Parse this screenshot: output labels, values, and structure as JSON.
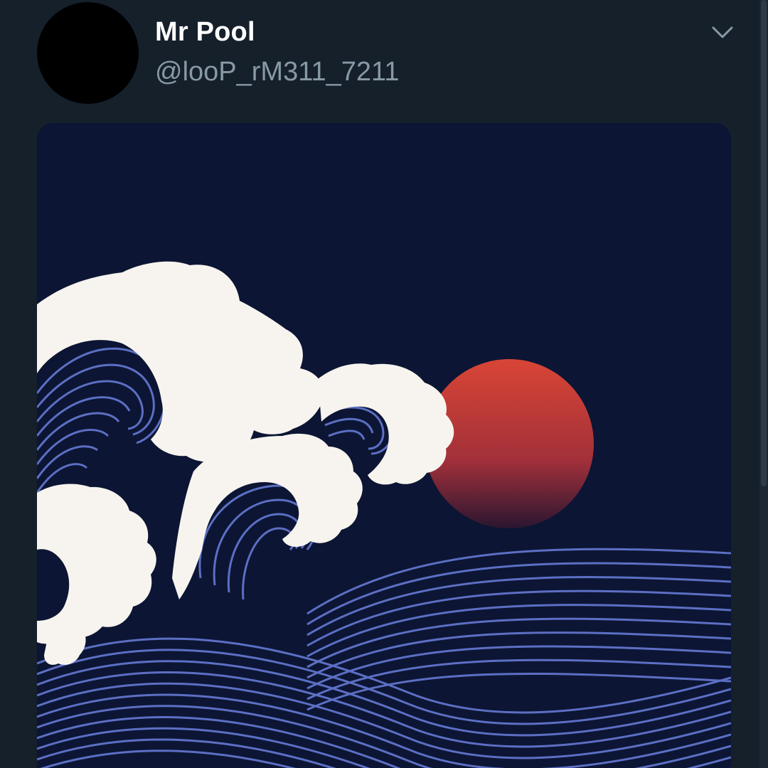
{
  "tweet": {
    "author": {
      "display_name": "Mr Pool",
      "handle": "@looP_rM311_7211",
      "avatar_color": "#000000"
    },
    "more_icon": "chevron-down-icon",
    "media": {
      "kind": "image",
      "colors": {
        "sky": "#0c1533",
        "sun_top": "#d94535",
        "sun_bottom": "#2a1630",
        "foam": "#f7f4ef",
        "wave_line": "#5c6fc4"
      }
    }
  },
  "theme": {
    "background": "#15202b",
    "name_color": "#ffffff",
    "handle_color": "#8899a6"
  }
}
